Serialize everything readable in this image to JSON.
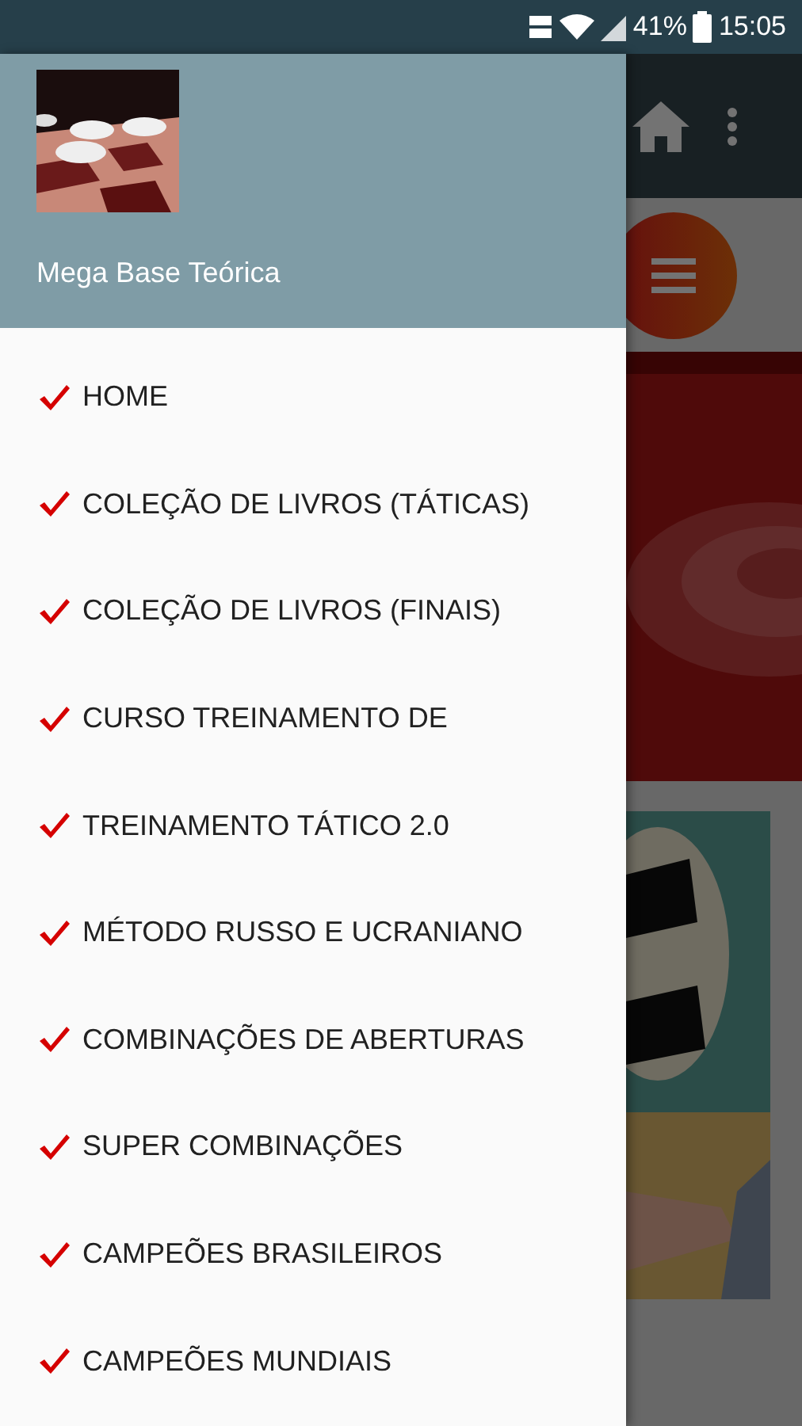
{
  "status_bar": {
    "battery": "41%",
    "time": "15:05"
  },
  "drawer": {
    "title": "Mega Base Teórica",
    "items": [
      {
        "label": "HOME"
      },
      {
        "label": "COLEÇÃO DE LIVROS (TÁTICAS)"
      },
      {
        "label": "COLEÇÃO DE LIVROS (FINAIS)"
      },
      {
        "label": "CURSO TREINAMENTO DE"
      },
      {
        "label": "TREINAMENTO TÁTICO 2.0"
      },
      {
        "label": "MÉTODO RUSSO E UCRANIANO"
      },
      {
        "label": "COMBINAÇÕES DE ABERTURAS"
      },
      {
        "label": "SUPER COMBINAÇÕES"
      },
      {
        "label": "CAMPEÕES BRASILEIROS"
      },
      {
        "label": "CAMPEÕES MUNDIAIS"
      }
    ]
  }
}
